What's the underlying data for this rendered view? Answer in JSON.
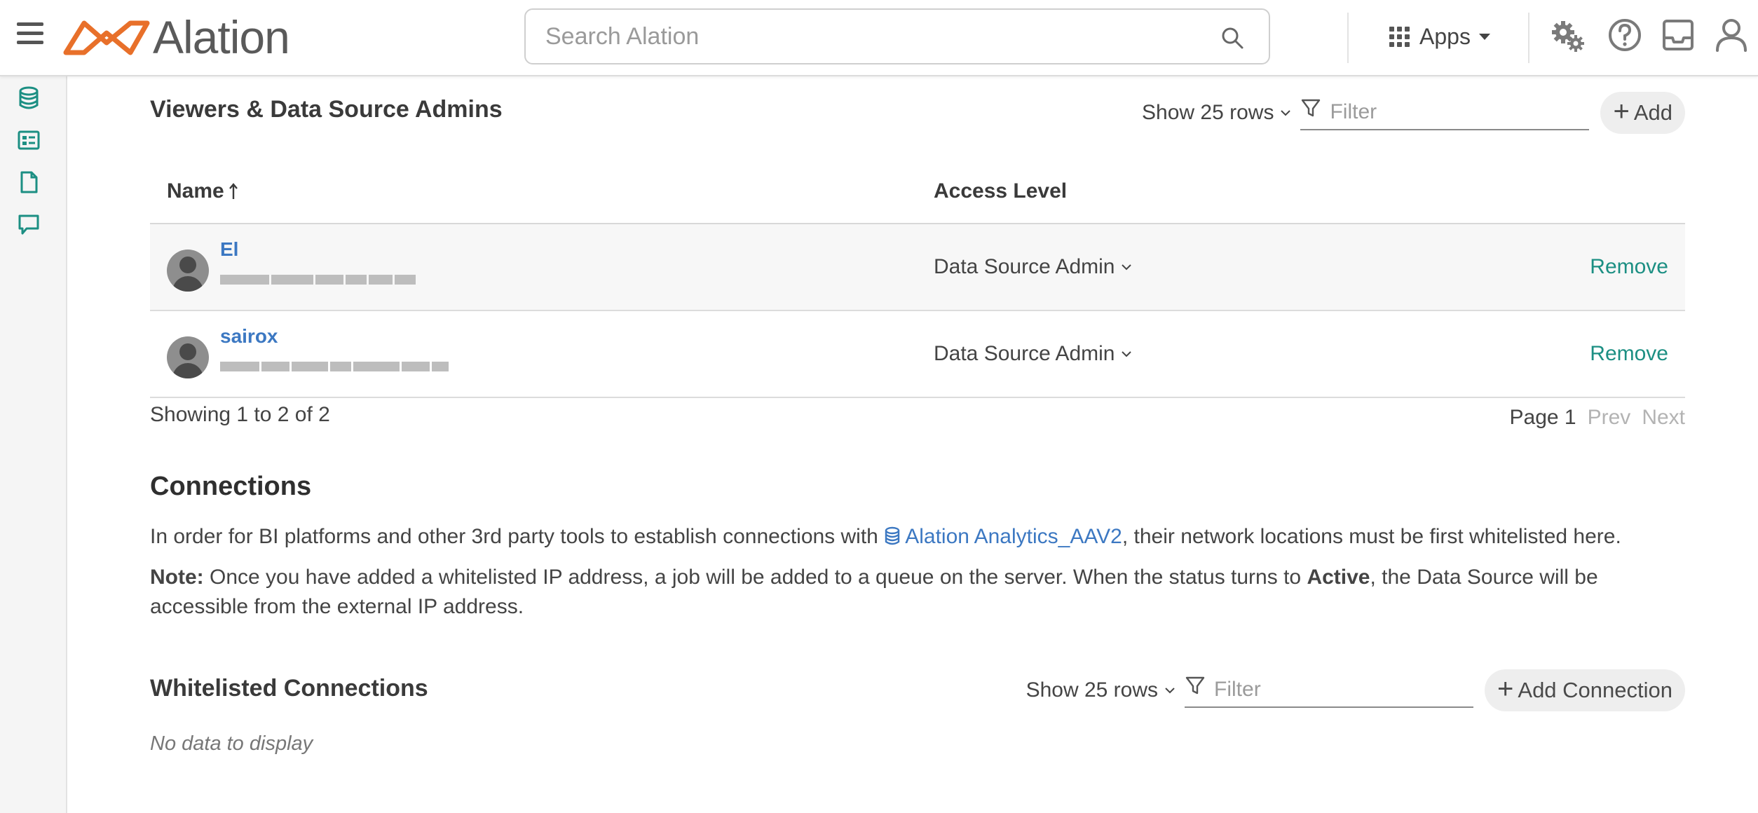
{
  "header": {
    "logo_text": "Alation",
    "search_placeholder": "Search Alation",
    "apps_label": "Apps",
    "icons": [
      "menu-icon",
      "search-icon",
      "apps-grid-icon",
      "settings-gears-icon",
      "help-icon",
      "inbox-icon",
      "user-icon"
    ]
  },
  "sidebar": {
    "icons": [
      "database-icon",
      "catalog-card-icon",
      "document-icon",
      "conversation-icon"
    ],
    "accent_color": "#1c8f83"
  },
  "viewers": {
    "title": "Viewers & Data Source Admins",
    "show_rows": "Show 25 rows",
    "filter_placeholder": "Filter",
    "add_label": "Add",
    "columns": {
      "name": "Name",
      "access": "Access Level"
    },
    "rows": [
      {
        "name": "El",
        "access": "Data Source Admin",
        "action": "Remove"
      },
      {
        "name": "sairox",
        "access": "Data Source Admin",
        "action": "Remove"
      }
    ],
    "showing": "Showing 1 to 2 of 2",
    "page": "Page 1",
    "prev": "Prev",
    "next": "Next"
  },
  "connections": {
    "title": "Connections",
    "intro_before": "In order for BI platforms and other 3rd party tools to establish connections with ",
    "datasource_link": "Alation Analytics_AAV2",
    "intro_after": ", their network locations must be first whitelisted here.",
    "note_label": "Note:",
    "note_text_1": " Once you have added a whitelisted IP address, a job will be added to a queue on the server. When the status turns to ",
    "note_bold": "Active",
    "note_text_2": ", the Data Source will be accessible from the external IP address."
  },
  "whitelisted": {
    "title": "Whitelisted Connections",
    "show_rows": "Show 25 rows",
    "filter_placeholder": "Filter",
    "add_label": "Add Connection",
    "empty_text": "No data to display"
  },
  "colors": {
    "link": "#3c78c2",
    "accent": "#1c8f83",
    "logo_orange": "#e8702a"
  }
}
